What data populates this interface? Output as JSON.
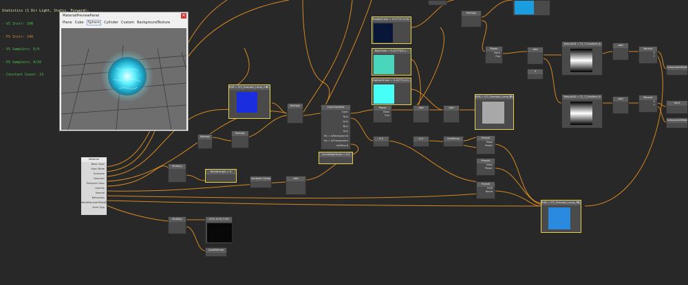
{
  "stats": {
    "line1": "Statistics (1 Dir Light, Static, Forward):",
    "line2": "- VS Instr: 100",
    "line3": "- PS Instr: 240",
    "line4": "- VS Samplers: 0/4",
    "line5": "- PS Samplers: 4/16",
    "line6": "- Constant Count: 23",
    "color_title": "#f0e6b0",
    "color_ok": "#4fc04f",
    "color_warn": "#d08a3a"
  },
  "preview": {
    "title": "MaterialPreviewPanel",
    "tabs": [
      "Plane",
      "Cube",
      "Sphere",
      "Cylinder",
      "Custom",
      "BackgroundTexture"
    ],
    "active_tab": "Sphere"
  },
  "material": {
    "title": "Material",
    "inputs": [
      "Base Color",
      "Spec Mode",
      "Emissive",
      "Specular",
      "Emissive Color",
      "Opacity",
      "Normal",
      "Refraction",
      "WorldNormalOffset/Mask",
      "Anim Opp"
    ]
  },
  "nodes": {
    "multiply": "Multiply",
    "power": "Power",
    "add": "Add",
    "normal": "Normal",
    "vec3": "Vec3",
    "colorgradient": "ColorGradient",
    "constant_clamp": "Constant Clamp",
    "bland_length": "BlendLength = 3",
    "curve_brightness": "CurveBrightness = 0.5",
    "shadow_color": "ShadowColor = 0.07710.0.08...",
    "base_color": "BaseColor = 0.42776,0.1...",
    "highlight_color": "HighlightColor = 0.42771,0.0...",
    "tex_1": "RGB = LT2_Example_Lamp_Cry...",
    "tex_2": "RGB = LT2_Example_Lamp_Cry...",
    "tex_3": "RGB = LT2_Example_Lamp_Cry...",
    "texture_grad_1": "Texture2D = T2_T_Gradient_B",
    "texture_grad_2": "Texture2D = T2_T_Gradient_B",
    "component_mask": "ComponentMask",
    "local_normal": "LocalNormal",
    "const_vec": "0.03, 0.03, 0.03",
    "fresnel": "Fresnel",
    "one_minus": "OneMinus",
    "c_04": "0.4",
    "c_05": "0.5",
    "c_3": "3",
    "pin_color": "Color",
    "pin_alpha": "Alpha",
    "pin_mask": "Mask",
    "pin_power": "Power",
    "pin_base": "Base",
    "pin_exp": "Exp",
    "pin_x": "X",
    "pin_y": "Y",
    "pin_rgb": "RGB",
    "pin_blend": "Blend",
    "grad_ports": [
      "Color",
      "R(x)",
      "G(x)",
      "B(x)",
      "A(x)",
      "Ha = A/Background",
      "Ha = A/Transparent",
      "Vis/Result"
    ]
  }
}
